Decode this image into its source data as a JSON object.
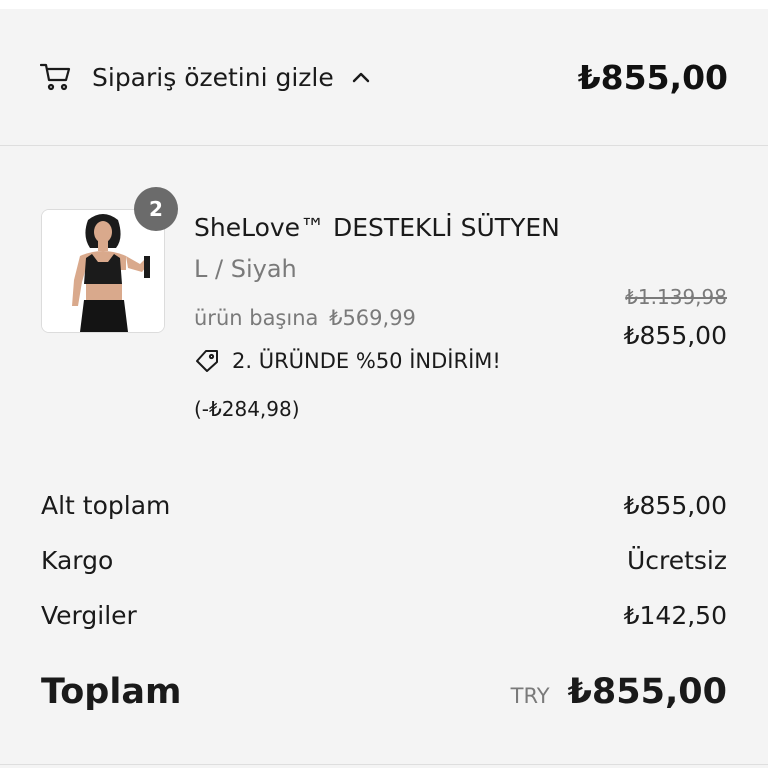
{
  "header": {
    "toggle_label": "Sipariş özetini gizle",
    "total": "₺855,00"
  },
  "item": {
    "quantity": "2",
    "name": "SheLove™ DESTEKLİ SÜTYEN",
    "variant": "L / Siyah",
    "unit_prefix": "ürün başına",
    "unit_price": "₺569,99",
    "discount_label": "2. ÜRÜNDE %50 İNDİRİM!",
    "discount_amount": "(-₺284,98)",
    "original_price": "₺1.139,98",
    "final_price": "₺855,00"
  },
  "summary": {
    "subtotal_label": "Alt toplam",
    "subtotal_value": "₺855,00",
    "shipping_label": "Kargo",
    "shipping_value": "Ücretsiz",
    "taxes_label": "Vergiler",
    "taxes_value": "₺142,50",
    "total_label": "Toplam",
    "currency": "TRY",
    "total_value": "₺855,00"
  },
  "colors": {
    "background": "#f4f4f4",
    "badge": "#6b6b6b",
    "muted_text": "#7a7a7a"
  }
}
